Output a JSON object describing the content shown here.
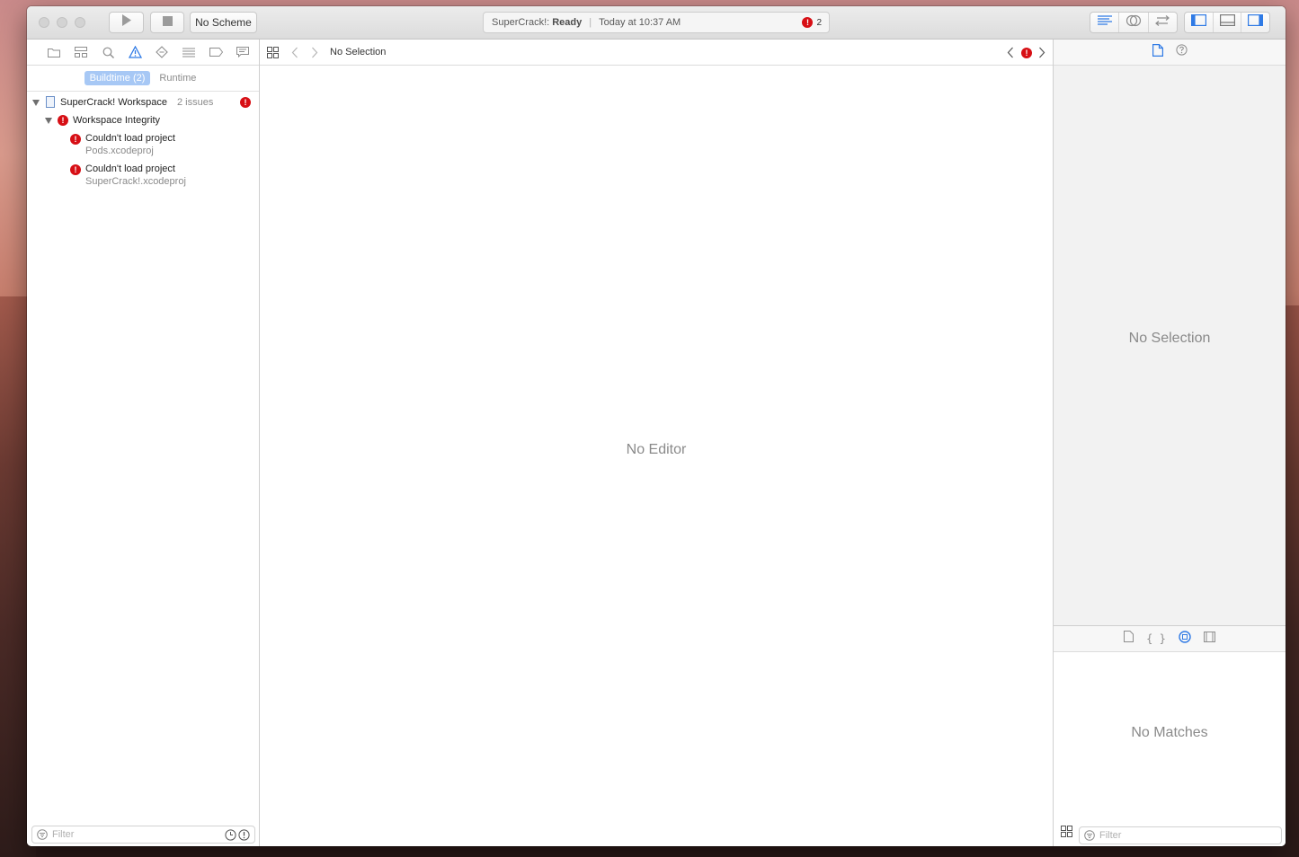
{
  "toolbar": {
    "scheme_label": "No Scheme",
    "activity": {
      "project": "SuperCrack!:",
      "state": "Ready",
      "time": "Today at 10:37 AM",
      "error_count": "2"
    }
  },
  "navigator": {
    "filters": [
      "Buildtime (2)",
      "Runtime"
    ],
    "tree": {
      "workspace_label": "SuperCrack! Workspace",
      "workspace_issue_count": "2 issues",
      "group_label": "Workspace Integrity",
      "issues": [
        {
          "message": "Couldn't load project",
          "file": "Pods.xcodeproj"
        },
        {
          "message": "Couldn't load project",
          "file": "SuperCrack!.xcodeproj"
        }
      ]
    },
    "filter_placeholder": "Filter"
  },
  "editor": {
    "jump_bar_label": "No Selection",
    "empty_message": "No Editor"
  },
  "inspector": {
    "empty_message": "No Selection",
    "library_empty_message": "No Matches",
    "library_filter_placeholder": "Filter"
  },
  "colors": {
    "error_red": "#d70f15",
    "accent_blue": "#2f7ae5",
    "active_filter": "#a7c8f5"
  }
}
